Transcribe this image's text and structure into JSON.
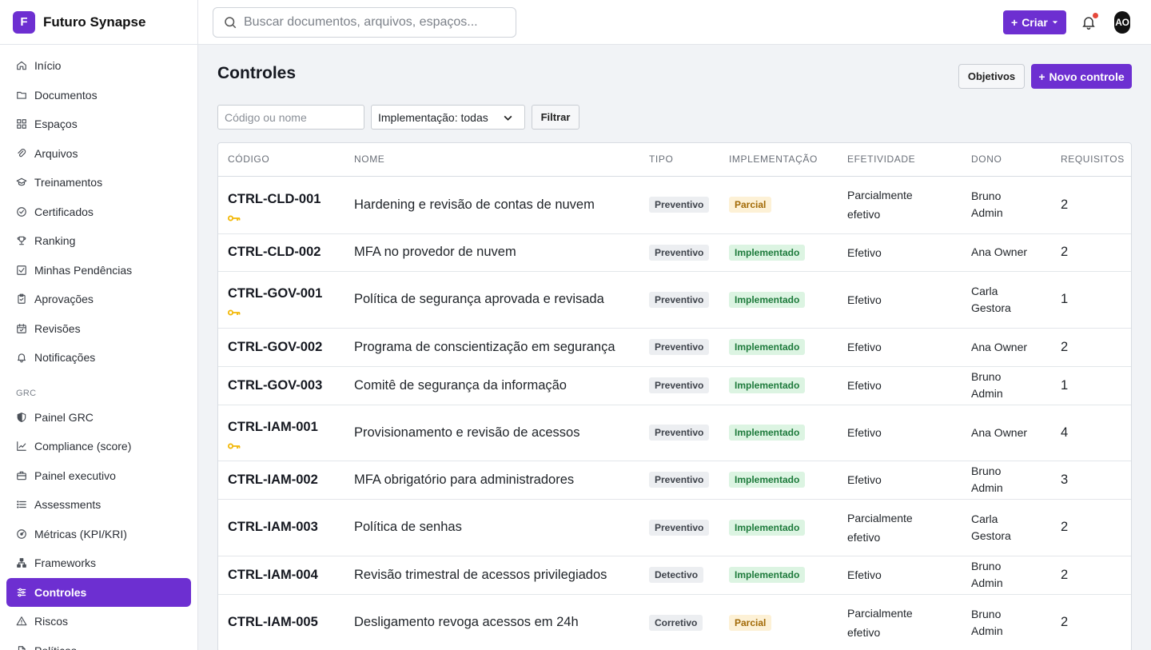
{
  "brand": {
    "logo_letter": "F",
    "name": "Futuro Synapse"
  },
  "search": {
    "placeholder": "Buscar documentos, arquivos, espaços..."
  },
  "topbar": {
    "create_label": "Criar",
    "avatar_initials": "AO"
  },
  "sidebar": {
    "items": [
      {
        "label": "Início",
        "icon": "home-icon"
      },
      {
        "label": "Documentos",
        "icon": "folder-icon"
      },
      {
        "label": "Espaços",
        "icon": "grid-icon"
      },
      {
        "label": "Arquivos",
        "icon": "paperclip-icon"
      },
      {
        "label": "Treinamentos",
        "icon": "graduation-cap-icon"
      },
      {
        "label": "Certificados",
        "icon": "badge-check-icon"
      },
      {
        "label": "Ranking",
        "icon": "trophy-icon"
      },
      {
        "label": "Minhas Pendências",
        "icon": "checkbox-icon"
      },
      {
        "label": "Aprovações",
        "icon": "clipboard-check-icon"
      },
      {
        "label": "Revisões",
        "icon": "calendar-check-icon"
      },
      {
        "label": "Notificações",
        "icon": "bell-icon"
      }
    ],
    "section_label": "GRC",
    "grc_items": [
      {
        "label": "Painel GRC",
        "icon": "shield-icon"
      },
      {
        "label": "Compliance (score)",
        "icon": "trend-chart-icon"
      },
      {
        "label": "Painel executivo",
        "icon": "briefcase-icon"
      },
      {
        "label": "Assessments",
        "icon": "list-icon"
      },
      {
        "label": "Métricas (KPI/KRI)",
        "icon": "gauge-icon"
      },
      {
        "label": "Frameworks",
        "icon": "hierarchy-icon"
      },
      {
        "label": "Controles",
        "icon": "sliders-icon",
        "active": true
      },
      {
        "label": "Riscos",
        "icon": "warning-icon"
      },
      {
        "label": "Políticas",
        "icon": "document-icon"
      }
    ]
  },
  "page": {
    "title": "Controles",
    "objetivos_label": "Objetivos",
    "novo_label": "Novo controle"
  },
  "filters": {
    "search_placeholder": "Código ou nome",
    "implementation_select": "Implementação: todas",
    "filter_label": "Filtrar"
  },
  "table": {
    "headers": [
      "CÓDIGO",
      "NOME",
      "TIPO",
      "IMPLEMENTAÇÃO",
      "EFETIVIDADE",
      "DONO",
      "REQUISITOS"
    ],
    "rows": [
      {
        "code": "CTRL-CLD-001",
        "key": true,
        "name": "Hardening e revisão de contas de nuvem",
        "type": "Preventivo",
        "impl": "Parcial",
        "eff": "Parcialmente efetivo",
        "owner": "Bruno Admin",
        "req": "2"
      },
      {
        "code": "CTRL-CLD-002",
        "key": false,
        "name": "MFA no provedor de nuvem",
        "type": "Preventivo",
        "impl": "Implementado",
        "eff": "Efetivo",
        "owner": "Ana Owner",
        "req": "2"
      },
      {
        "code": "CTRL-GOV-001",
        "key": true,
        "name": "Política de segurança aprovada e revisada",
        "type": "Preventivo",
        "impl": "Implementado",
        "eff": "Efetivo",
        "owner": "Carla Gestora",
        "req": "1"
      },
      {
        "code": "CTRL-GOV-002",
        "key": false,
        "name": "Programa de conscientização em segurança",
        "type": "Preventivo",
        "impl": "Implementado",
        "eff": "Efetivo",
        "owner": "Ana Owner",
        "req": "2"
      },
      {
        "code": "CTRL-GOV-003",
        "key": false,
        "name": "Comitê de segurança da informação",
        "type": "Preventivo",
        "impl": "Implementado",
        "eff": "Efetivo",
        "owner": "Bruno Admin",
        "req": "1"
      },
      {
        "code": "CTRL-IAM-001",
        "key": true,
        "name": "Provisionamento e revisão de acessos",
        "type": "Preventivo",
        "impl": "Implementado",
        "eff": "Efetivo",
        "owner": "Ana Owner",
        "req": "4"
      },
      {
        "code": "CTRL-IAM-002",
        "key": false,
        "name": "MFA obrigatório para administradores",
        "type": "Preventivo",
        "impl": "Implementado",
        "eff": "Efetivo",
        "owner": "Bruno Admin",
        "req": "3"
      },
      {
        "code": "CTRL-IAM-003",
        "key": false,
        "name": "Política de senhas",
        "type": "Preventivo",
        "impl": "Implementado",
        "eff": "Parcialmente efetivo",
        "owner": "Carla Gestora",
        "req": "2"
      },
      {
        "code": "CTRL-IAM-004",
        "key": false,
        "name": "Revisão trimestral de acessos privilegiados",
        "type": "Detectivo",
        "impl": "Implementado",
        "eff": "Efetivo",
        "owner": "Bruno Admin",
        "req": "2"
      },
      {
        "code": "CTRL-IAM-005",
        "key": false,
        "name": "Desligamento revoga acessos em 24h",
        "type": "Corretivo",
        "impl": "Parcial",
        "eff": "Parcialmente efetivo",
        "owner": "Bruno Admin",
        "req": "2"
      }
    ]
  },
  "colors": {
    "accent": "#6d2fd1",
    "key_icon": "#f2b705",
    "notification_dot": "#e5483b"
  }
}
